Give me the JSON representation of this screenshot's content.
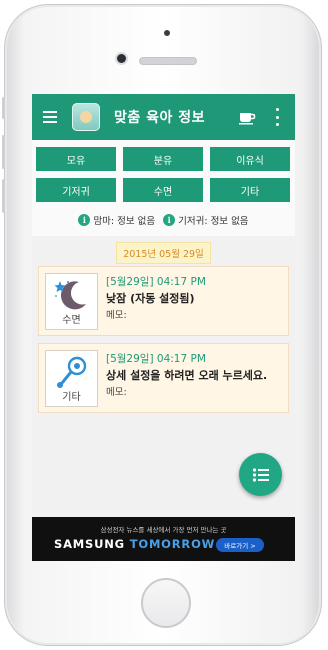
{
  "app": {
    "title": "맞춤 육아 정보"
  },
  "buttons": [
    "모유",
    "분유",
    "이유식",
    "기저귀",
    "수면",
    "기타"
  ],
  "info": {
    "mom": "맘마: 정보 없음",
    "diaper": "기저귀: 정보 없음"
  },
  "date": "2015년 05월 29일",
  "records": [
    {
      "icon": "moon-star-icon",
      "category": "수면",
      "time": "[5월29일] 04:17 PM",
      "title": "낮잠 (자동 설정됨)",
      "memo": "메모:"
    },
    {
      "icon": "rattle-icon",
      "category": "기타",
      "time": "[5월29일] 04:17 PM",
      "title": "상세 설정을 하려면 오래 누르세요.",
      "memo": "메모:"
    }
  ],
  "ad": {
    "tagline": "삼성전자 뉴스를 세상에서 가장 먼저 만나는 곳",
    "brand_left": "SAMSUNG ",
    "brand_right": "TOMORROW",
    "cta": "바로가기 >"
  },
  "colors": {
    "primary": "#1e9877",
    "button": "#1f9a78",
    "date_text": "#d58c25",
    "card_bg": "#fff6e6"
  }
}
